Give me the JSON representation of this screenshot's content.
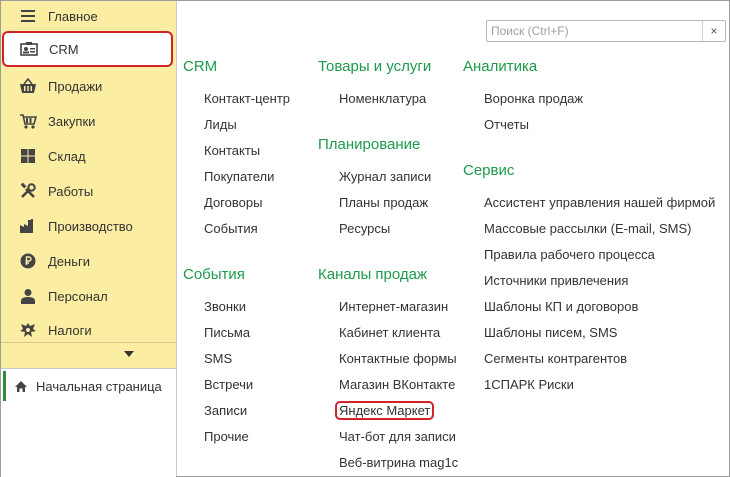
{
  "sidebar": {
    "items": [
      {
        "label": "Главное",
        "icon": "menu-lines-icon"
      },
      {
        "label": "CRM",
        "icon": "contact-card-icon"
      },
      {
        "label": "Продажи",
        "icon": "basket-icon"
      },
      {
        "label": "Закупки",
        "icon": "cart-icon"
      },
      {
        "label": "Склад",
        "icon": "warehouse-grid-icon"
      },
      {
        "label": "Работы",
        "icon": "tools-icon"
      },
      {
        "label": "Производство",
        "icon": "factory-icon"
      },
      {
        "label": "Деньги",
        "icon": "ruble-coin-icon"
      },
      {
        "label": "Персонал",
        "icon": "person-icon"
      },
      {
        "label": "Налоги",
        "icon": "eagle-emblem-icon"
      }
    ],
    "home": {
      "label": "Начальная страница",
      "icon": "home-icon"
    }
  },
  "search": {
    "placeholder": "Поиск (Ctrl+F)",
    "clear_label": "×"
  },
  "columns": {
    "crm": {
      "title": "CRM",
      "links": [
        "Контакт-центр",
        "Лиды",
        "Контакты",
        "Покупатели",
        "Договоры",
        "События"
      ]
    },
    "events": {
      "title": "События",
      "links": [
        "Звонки",
        "Письма",
        "SMS",
        "Встречи",
        "Записи",
        "Прочие"
      ]
    },
    "goods": {
      "title": "Товары и услуги",
      "links": [
        "Номенклатура"
      ]
    },
    "planning": {
      "title": "Планирование",
      "links": [
        "Журнал записи",
        "Планы продаж",
        "Ресурсы"
      ]
    },
    "channels": {
      "title": "Каналы продаж",
      "links": [
        "Интернет-магазин",
        "Кабинет клиента",
        "Контактные формы",
        "Магазин ВКонтакте",
        "Яндекс Маркет",
        "Чат-бот для записи",
        "Веб-витрина mag1c"
      ]
    },
    "analytics": {
      "title": "Аналитика",
      "links": [
        "Воронка продаж",
        "Отчеты"
      ]
    },
    "service": {
      "title": "Сервис",
      "links": [
        "Ассистент управления нашей фирмой",
        "Массовые рассылки (E-mail, SMS)",
        "Правила рабочего процесса",
        "Источники привлечения",
        "Шаблоны КП и договоров",
        "Шаблоны писем, SMS",
        "Сегменты контрагентов",
        "1СПАРК Риски"
      ]
    }
  },
  "colors": {
    "accent_green": "#1e9a4b",
    "highlight_red": "#d2232a",
    "sidebar_bg": "#fbeda2"
  }
}
